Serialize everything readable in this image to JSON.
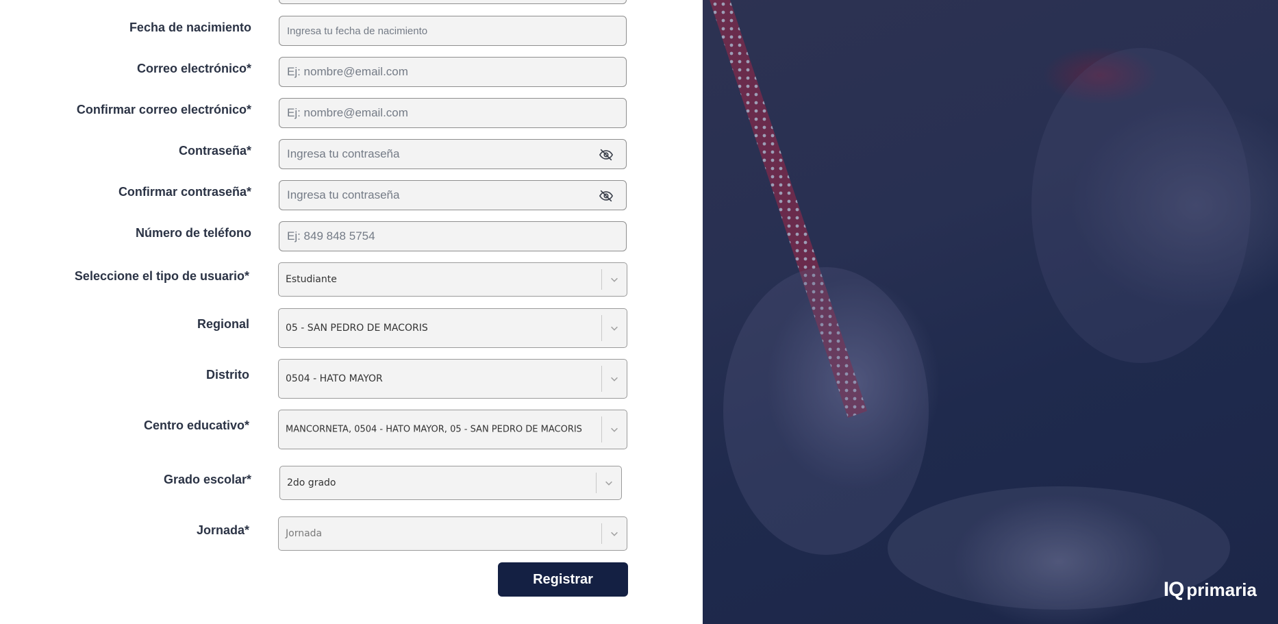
{
  "form": {
    "fields": [
      {
        "label": "Fecha de nacimiento",
        "placeholder": "Ingresa tu fecha de nacimiento"
      },
      {
        "label": "Correo electrónico*",
        "placeholder": "Ej: nombre@email.com"
      },
      {
        "label": "Confirmar correo electrónico*",
        "placeholder": "Ej: nombre@email.com"
      },
      {
        "label": "Contraseña*",
        "placeholder": "Ingresa tu contraseña",
        "icon": "eye-off-icon"
      },
      {
        "label": "Confirmar contraseña*",
        "placeholder": "Ingresa tu contraseña",
        "icon": "eye-off-icon"
      },
      {
        "label": "Número de teléfono",
        "placeholder": "Ej: 849 848 5754"
      }
    ],
    "selects": [
      {
        "label": "Seleccione el tipo de usuario*",
        "value": "Estudiante"
      },
      {
        "label": "Regional",
        "value": "05 - SAN PEDRO DE MACORIS"
      },
      {
        "label": "Distrito",
        "value": "0504 - HATO MAYOR"
      },
      {
        "label": "Centro educativo*",
        "value": "MANCORNETA, 0504 - HATO MAYOR, 05 - SAN PEDRO DE MACORIS"
      },
      {
        "label": "Grado escolar*",
        "value": "2do grado"
      },
      {
        "label": "Jornada*",
        "placeholder": "Jornada"
      }
    ],
    "submit_label": "Registrar"
  },
  "brand": {
    "logo_mark": "IQ",
    "logo_text": "primaria"
  },
  "colors": {
    "primary": "#142043",
    "field_bg": "#f3f3f3",
    "hero_overlay": "#1f2a4d"
  }
}
